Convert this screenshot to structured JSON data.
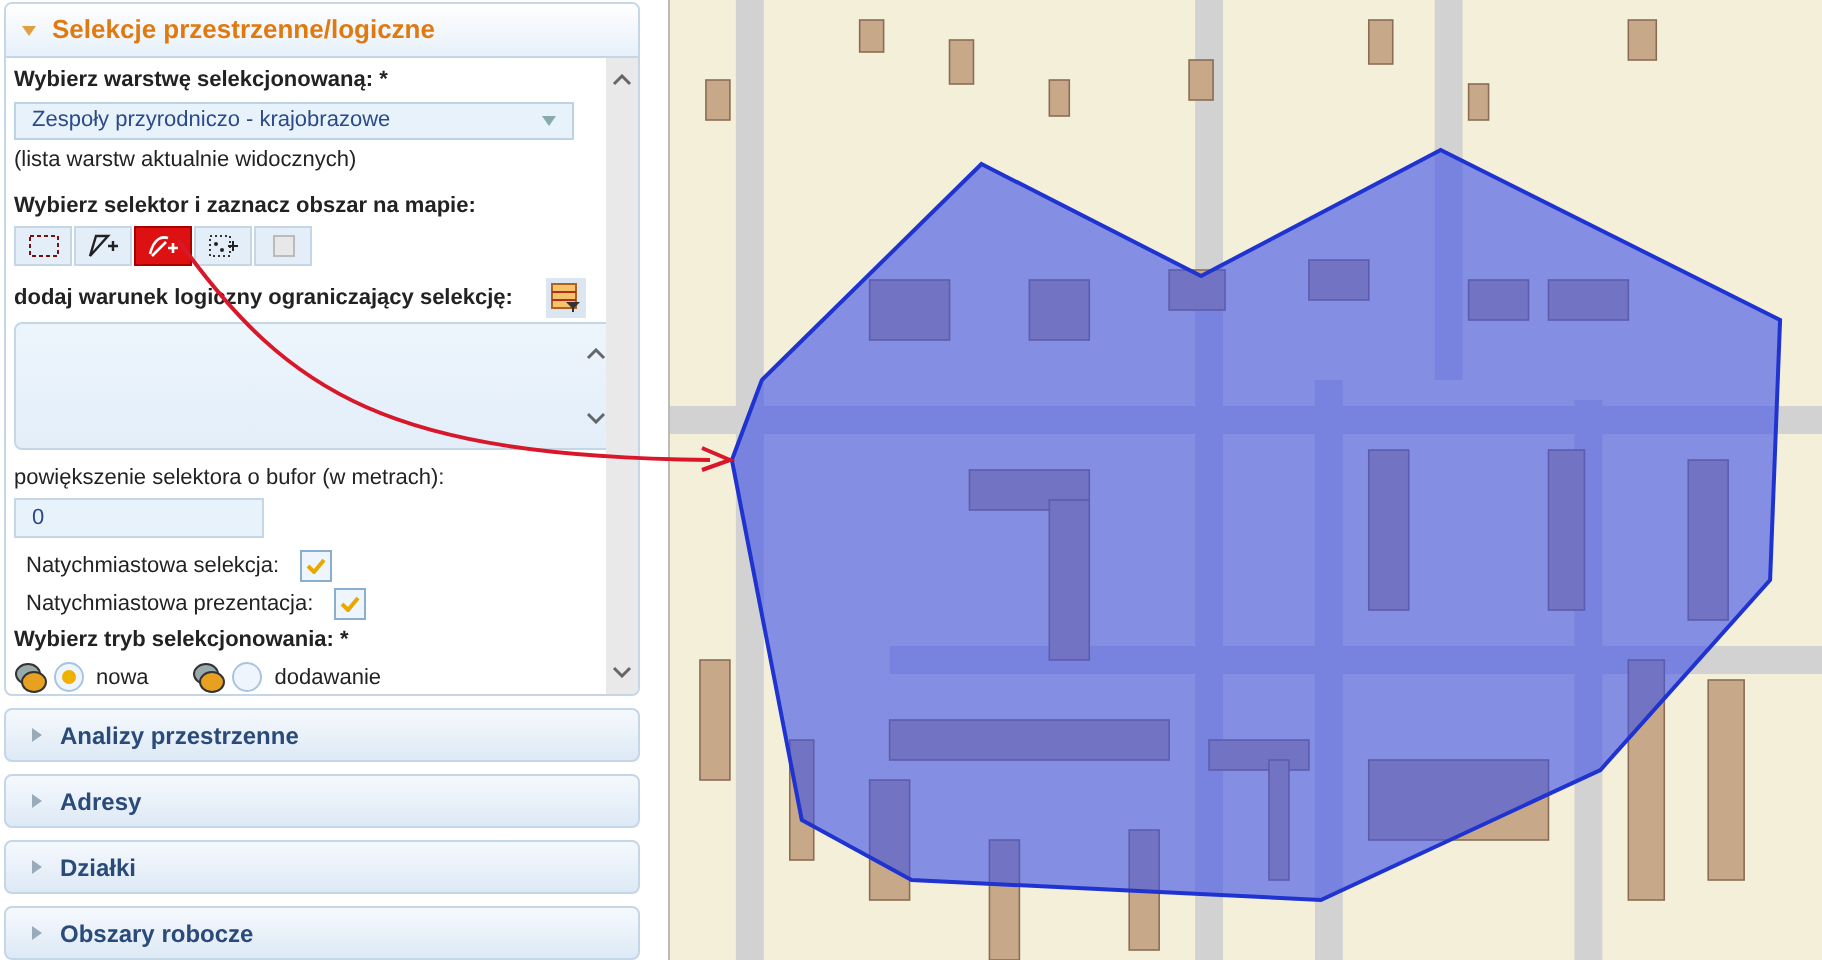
{
  "panel": {
    "title": "Selekcje przestrzenne/logiczne",
    "expanded": true,
    "layer_label": "Wybierz warstwę selekcjonowaną: *",
    "layer_select": {
      "value": "Zespoły przyrodniczo - krajobrazowe"
    },
    "layer_note": "(lista warstw aktualnie widocznych)",
    "selector_label": "Wybierz selektor i zaznacz obszar na mapie:",
    "selectors": [
      {
        "kind": "rectangle",
        "selected": false
      },
      {
        "kind": "polygon",
        "selected": false
      },
      {
        "kind": "freehand",
        "selected": true
      },
      {
        "kind": "points",
        "selected": false
      },
      {
        "kind": "clear",
        "selected": false
      }
    ],
    "condition_label": "dodaj warunek logiczny ograniczający selekcję:",
    "buffer_label": "powiększenie selektora o bufor (w metrach):",
    "buffer_input": {
      "value": "0"
    },
    "checkboxes": [
      {
        "label": "Natychmiastowa selekcja:",
        "checked": true
      },
      {
        "label": "Natychmiastowa prezentacja:",
        "checked": true
      }
    ],
    "mode_label": "Wybierz tryb selekcjonowania: *",
    "modes": [
      {
        "label": "nowa",
        "selected": true
      },
      {
        "label": "dodawanie",
        "selected": false
      }
    ]
  },
  "sections": [
    {
      "title": "Analizy przestrzenne",
      "expanded": false
    },
    {
      "title": "Adresy",
      "expanded": false
    },
    {
      "title": "Działki",
      "expanded": false
    },
    {
      "title": "Obszary robocze",
      "expanded": false
    }
  ]
}
